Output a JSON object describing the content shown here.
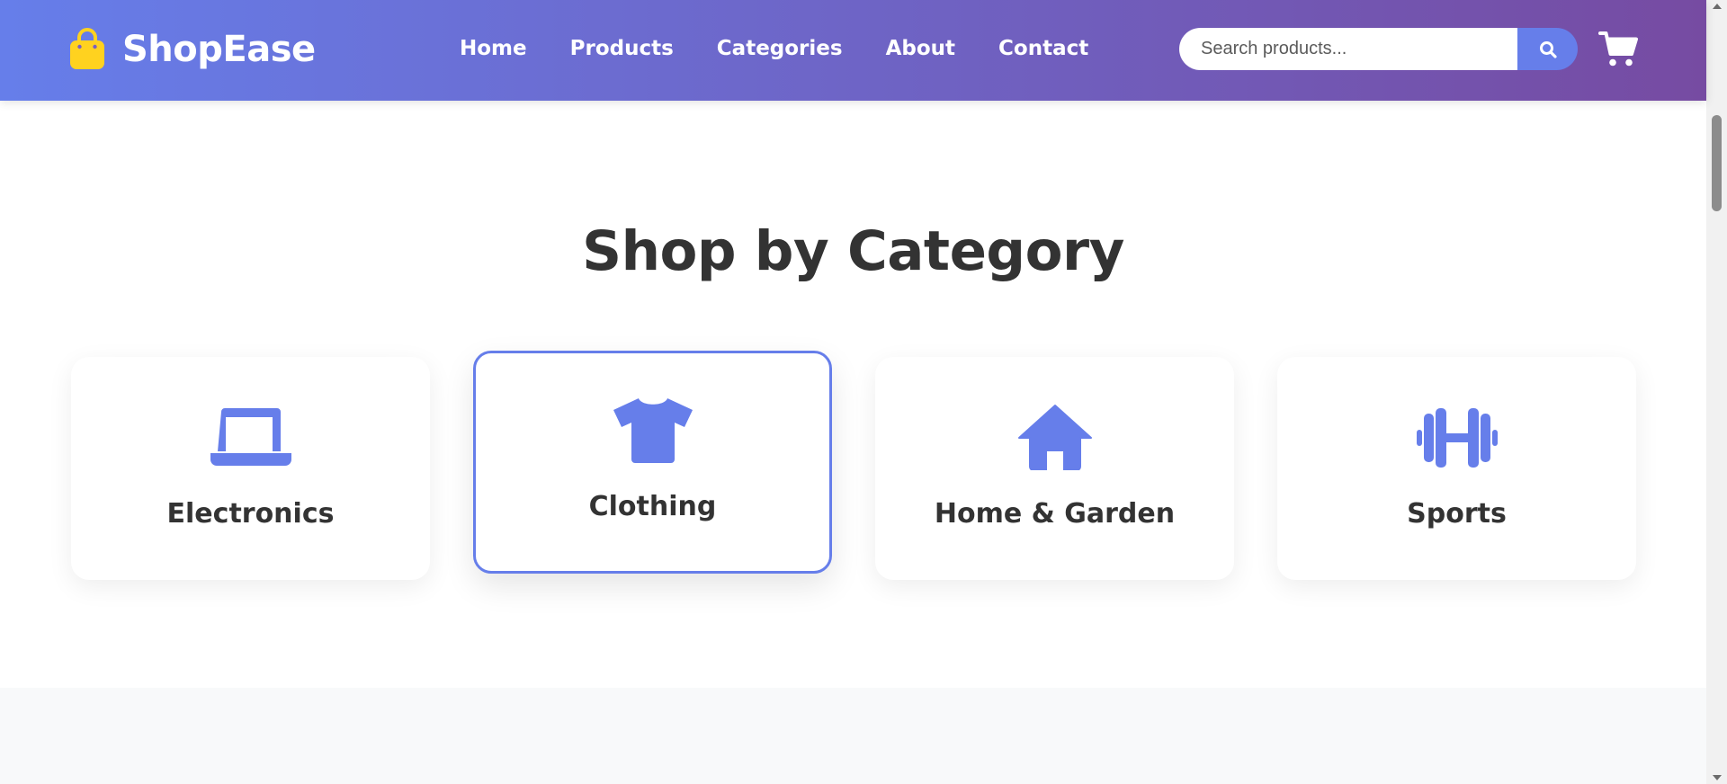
{
  "brand": {
    "name": "ShopEase",
    "icon": "shopping-bag-icon",
    "icon_color": "#FFD21F"
  },
  "nav": {
    "links": [
      {
        "label": "Home"
      },
      {
        "label": "Products"
      },
      {
        "label": "Categories"
      },
      {
        "label": "About"
      },
      {
        "label": "Contact"
      }
    ]
  },
  "search": {
    "placeholder": "Search products...",
    "value": "",
    "button_icon": "search-icon"
  },
  "cart": {
    "icon": "shopping-cart-icon"
  },
  "categories_section": {
    "title": "Shop by Category",
    "items": [
      {
        "label": "Electronics",
        "icon": "laptop-icon",
        "active": false
      },
      {
        "label": "Clothing",
        "icon": "tshirt-icon",
        "active": true
      },
      {
        "label": "Home & Garden",
        "icon": "home-icon",
        "active": false
      },
      {
        "label": "Sports",
        "icon": "dumbbell-icon",
        "active": false
      }
    ]
  },
  "colors": {
    "gradient_start": "#667eea",
    "gradient_end": "#764ba2",
    "accent": "#667eea",
    "text_dark": "#333333",
    "next_section_bg": "#f8f9fa"
  }
}
